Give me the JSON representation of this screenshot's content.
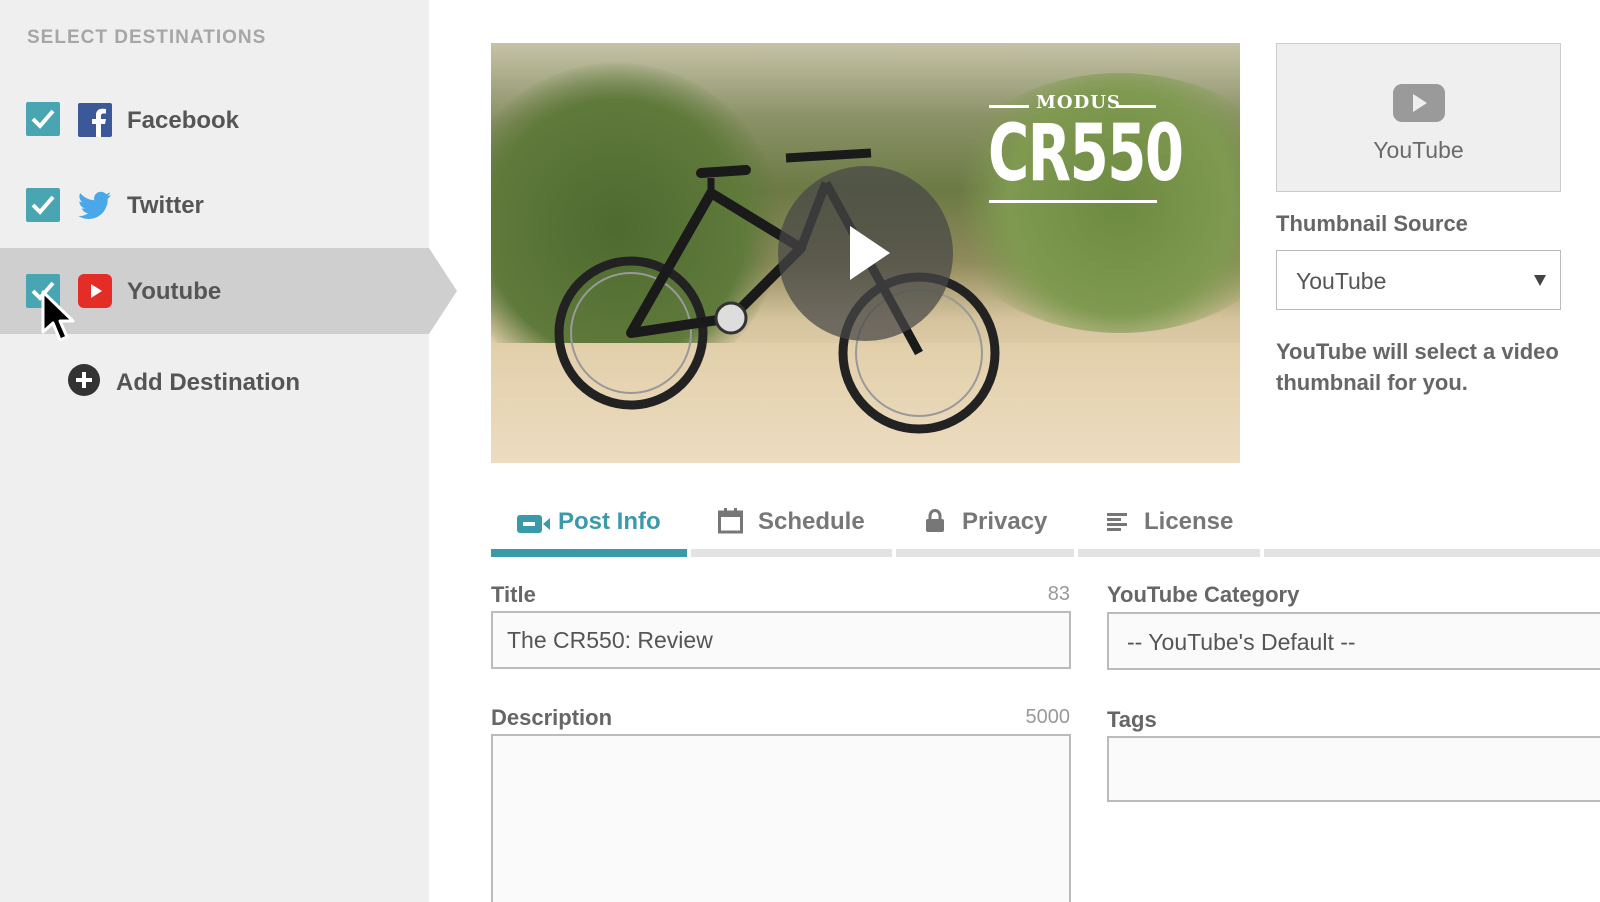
{
  "sidebar": {
    "heading": "SELECT DESTINATIONS",
    "destinations": [
      {
        "label": "Facebook",
        "checked": true,
        "icon": "facebook-icon",
        "color": "#3b5998"
      },
      {
        "label": "Twitter",
        "checked": true,
        "icon": "twitter-icon",
        "color": "#4aa8e8"
      },
      {
        "label": "Youtube",
        "checked": true,
        "icon": "youtube-icon",
        "color": "#e52d27",
        "selected": true
      }
    ],
    "add_label": "Add Destination"
  },
  "video": {
    "brand_small": "MODUS",
    "brand_big": "CR550"
  },
  "thumbnail": {
    "preview_label": "YouTube",
    "source_label": "Thumbnail Source",
    "source_value": "YouTube",
    "note": "YouTube will select a video thumbnail for you."
  },
  "tabs": [
    {
      "label": "Post Info",
      "icon": "video-camera-icon",
      "active": true
    },
    {
      "label": "Schedule",
      "icon": "calendar-icon",
      "active": false
    },
    {
      "label": "Privacy",
      "icon": "lock-icon",
      "active": false
    },
    {
      "label": "License",
      "icon": "lines-icon",
      "active": false
    }
  ],
  "form": {
    "title_label": "Title",
    "title_counter": "83",
    "title_value": "The CR550: Review",
    "category_label": "YouTube Category",
    "category_value": "-- YouTube's Default --",
    "description_label": "Description",
    "description_counter": "5000",
    "description_value": "",
    "tags_label": "Tags",
    "tags_value": ""
  },
  "colors": {
    "accent": "#3a9aaa",
    "checkbox": "#4aa5b3",
    "sidebar_bg": "#efefef",
    "selected_bg": "#cfcfcf"
  }
}
